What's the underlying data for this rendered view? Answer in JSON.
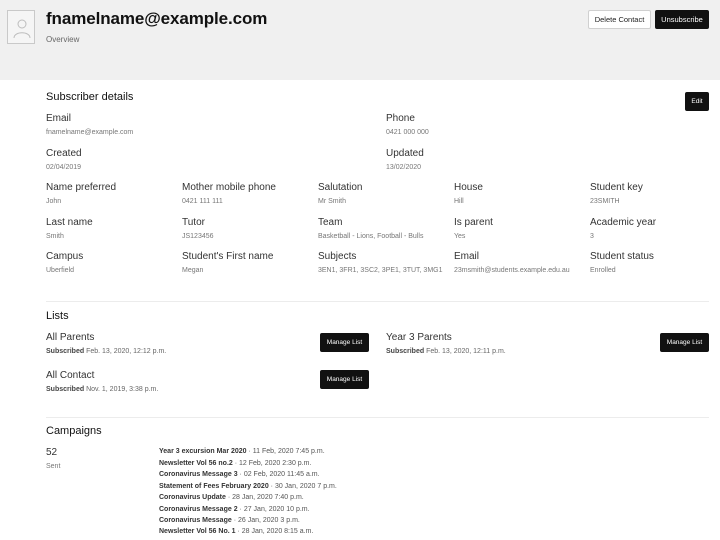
{
  "header": {
    "title": "fnamelname@example.com",
    "subtitle": "Overview",
    "delete_label": "Delete Contact",
    "unsubscribe_label": "Unsubscribe",
    "avatar_icon": "person-icon"
  },
  "subscriber": {
    "title": "Subscriber details",
    "edit_label": "Edit",
    "email_label": "Email",
    "email_value": "fnamelname@example.com",
    "phone_label": "Phone",
    "phone_value": "0421 000 000",
    "created_label": "Created",
    "created_value": "02/04/2019",
    "updated_label": "Updated",
    "updated_value": "13/02/2020",
    "fields": [
      {
        "label": "Name preferred",
        "value": "John"
      },
      {
        "label": "Mother mobile phone",
        "value": "0421 111 111"
      },
      {
        "label": "Salutation",
        "value": "Mr Smith"
      },
      {
        "label": "House",
        "value": "Hill"
      },
      {
        "label": "Student key",
        "value": "23SMITH"
      },
      {
        "label": "Last name",
        "value": "Smith"
      },
      {
        "label": "Tutor",
        "value": "JS123456"
      },
      {
        "label": "Team",
        "value": "Basketball - Lions, Football - Bulls"
      },
      {
        "label": "Is parent",
        "value": "Yes"
      },
      {
        "label": "Academic year",
        "value": "3"
      },
      {
        "label": "Campus",
        "value": "Uberfield"
      },
      {
        "label": "Student's First name",
        "value": "Megan"
      },
      {
        "label": "Subjects",
        "value": "3EN1, 3FR1, 3SC2, 3PE1, 3TUT, 3MG1"
      },
      {
        "label": "Email",
        "value": "23msmith@students.example.edu.au"
      },
      {
        "label": "Student status",
        "value": "Enrolled"
      }
    ]
  },
  "lists": {
    "title": "Lists",
    "manage_label": "Manage List",
    "subscribed_label": "Subscribed",
    "items": [
      {
        "name": "All Parents",
        "date": "Feb. 13, 2020, 12:12 p.m."
      },
      {
        "name": "Year 3 Parents",
        "date": "Feb. 13, 2020, 12:11 p.m."
      },
      {
        "name": "All Contact",
        "date": "Nov. 1, 2019, 3:38 p.m."
      }
    ]
  },
  "campaigns": {
    "title": "Campaigns",
    "count": "52",
    "count_label": "Sent",
    "items": [
      {
        "name": "Year 3 excursion Mar 2020",
        "date": " · 11 Feb, 2020 7:45 p.m."
      },
      {
        "name": "Newsletter Vol 56 no.2",
        "date": " · 12 Feb, 2020 2:30 p.m."
      },
      {
        "name": "Coronavirus Message 3",
        "date": " · 02 Feb, 2020 11:45 a.m."
      },
      {
        "name": "Statement of Fees February 2020",
        "date": " · 30 Jan, 2020 7 p.m."
      },
      {
        "name": "Coronavirus Update",
        "date": " · 28 Jan, 2020 7:40 p.m."
      },
      {
        "name": "Coronavirus Message 2",
        "date": " · 27 Jan, 2020 10 p.m."
      },
      {
        "name": "Coronavirus Message",
        "date": " · 26 Jan, 2020 3 p.m."
      },
      {
        "name": "Newsletter Vol 56 No. 1",
        "date": " · 28 Jan, 2020 8:15 a.m."
      }
    ]
  }
}
